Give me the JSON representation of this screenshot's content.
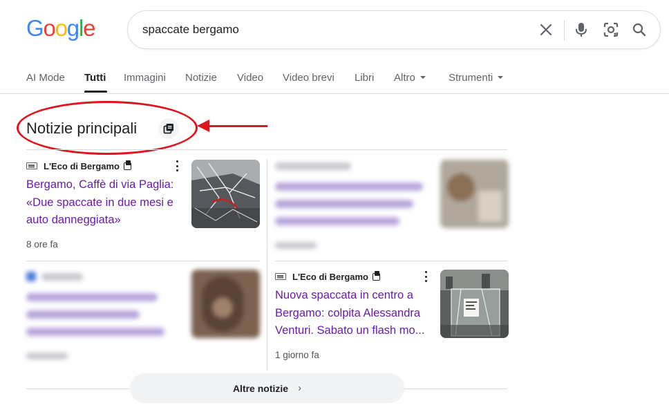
{
  "logo": {
    "letters": [
      "G",
      "o",
      "o",
      "g",
      "l",
      "e"
    ],
    "colors": [
      "#4285f4",
      "#ea4335",
      "#fbbc05",
      "#4285f4",
      "#34a853",
      "#ea4335"
    ]
  },
  "search": {
    "query": "spaccate bergamo",
    "icons": [
      "close-icon",
      "mic-icon",
      "lens-icon",
      "search-icon"
    ]
  },
  "tabs": [
    {
      "label": "AI Mode",
      "active": false
    },
    {
      "label": "Tutti",
      "active": true
    },
    {
      "label": "Immagini",
      "active": false
    },
    {
      "label": "Notizie",
      "active": false
    },
    {
      "label": "Video",
      "active": false
    },
    {
      "label": "Video brevi",
      "active": false
    },
    {
      "label": "Libri",
      "active": false
    },
    {
      "label": "Altro",
      "active": false,
      "dropdown": true
    },
    {
      "label": "Strumenti",
      "active": false,
      "dropdown": true
    }
  ],
  "section": {
    "title": "Notizie principali",
    "icon": "view-more-icon"
  },
  "annotation": {
    "color": "#e0141e",
    "shapes": [
      "ellipse",
      "arrow"
    ]
  },
  "cards": [
    {
      "source": "L'Eco di Bergamo",
      "headline": "Bergamo, Caffè di via Paglia: «Due spaccate in due mesi e auto danneggiata»",
      "time": "8 ore fa",
      "blurred": false
    },
    {
      "blurred": true
    },
    {
      "blurred": true
    },
    {
      "source": "L'Eco di Bergamo",
      "headline": "Nuova spaccata in centro a Bergamo: colpita Alessandra Venturi. Sabato un flash mo...",
      "time": "1 giorno fa",
      "blurred": false
    }
  ],
  "more_news": {
    "label": "Altre notizie"
  },
  "colors": {
    "link": "#681da8",
    "text": "#202124",
    "secondary": "#5f6368",
    "annotation": "#e0141e"
  }
}
